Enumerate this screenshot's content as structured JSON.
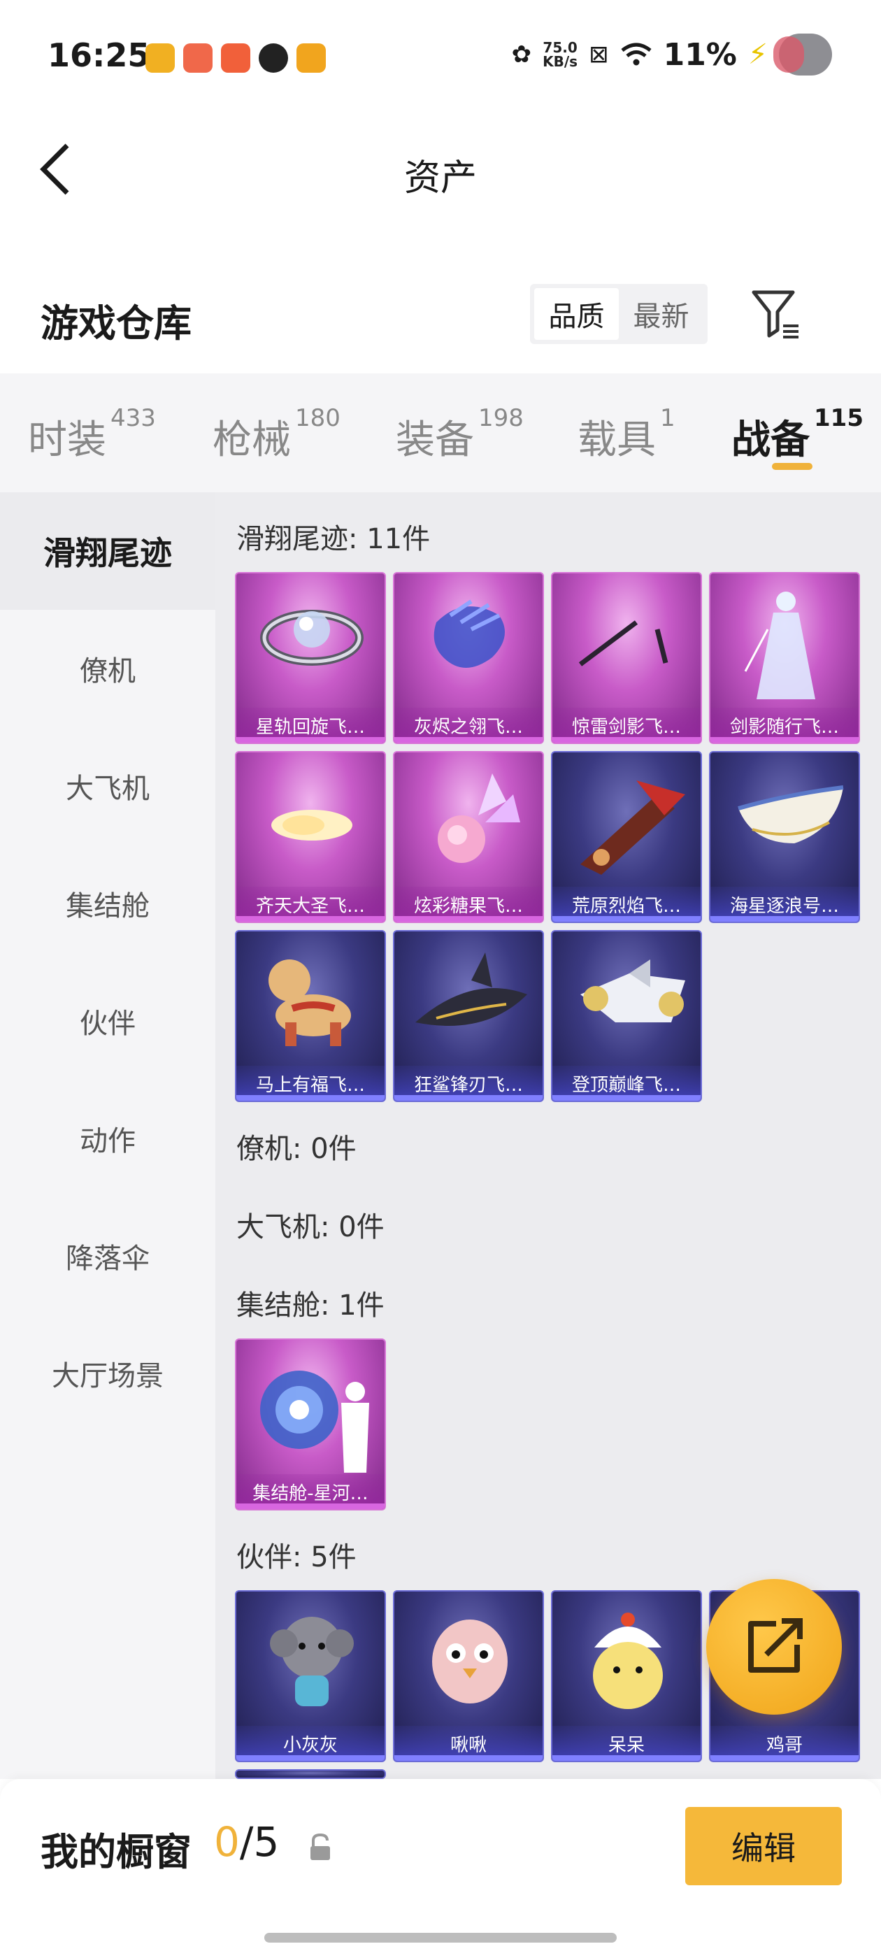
{
  "status_bar": {
    "time": "16:25",
    "net_speed": "75.0",
    "net_unit": "KB/s",
    "battery": "11%",
    "app_icon_colors": [
      "#f1b022",
      "#f0684a",
      "#f1603a",
      "#222222",
      "#f1a51e"
    ]
  },
  "header": {
    "title": "资产",
    "back_icon": "chevron-left-icon"
  },
  "warehouse": {
    "title": "游戏仓库",
    "sort_options": [
      "品质",
      "最新"
    ],
    "active_sort": "品质",
    "filter_icon": "filter-icon"
  },
  "tabs": [
    {
      "label": "时装",
      "count": "433"
    },
    {
      "label": "枪械",
      "count": "180"
    },
    {
      "label": "装备",
      "count": "198"
    },
    {
      "label": "载具",
      "count": "1"
    },
    {
      "label": "战备",
      "count": "115"
    }
  ],
  "active_tab": "战备",
  "sidebar": [
    "滑翔尾迹",
    "僚机",
    "大飞机",
    "集结舱",
    "伙伴",
    "动作",
    "降落伞",
    "大厅场景"
  ],
  "active_sidebar": "滑翔尾迹",
  "sections": {
    "glide_trail": {
      "title": "滑翔尾迹: 11件",
      "items": [
        {
          "label": "星轨回旋飞…",
          "rarity": "purple"
        },
        {
          "label": "灰烬之翎飞…",
          "rarity": "purple"
        },
        {
          "label": "惊雷剑影飞…",
          "rarity": "purple"
        },
        {
          "label": "剑影随行飞…",
          "rarity": "purple"
        },
        {
          "label": "齐天大圣飞…",
          "rarity": "purple"
        },
        {
          "label": "炫彩糖果飞…",
          "rarity": "purple"
        },
        {
          "label": "荒原烈焰飞…",
          "rarity": "blue"
        },
        {
          "label": "海星逐浪号…",
          "rarity": "blue"
        },
        {
          "label": "马上有福飞…",
          "rarity": "blue"
        },
        {
          "label": "狂鲨锋刃飞…",
          "rarity": "blue"
        },
        {
          "label": "登顶巅峰飞…",
          "rarity": "blue"
        }
      ]
    },
    "wingman": {
      "title": "僚机: 0件"
    },
    "big_plane": {
      "title": "大飞机: 0件"
    },
    "assembly_pod": {
      "title": "集结舱: 1件",
      "items": [
        {
          "label": "集结舱-星河…",
          "rarity": "purple"
        }
      ]
    },
    "partner": {
      "title": "伙伴: 5件",
      "items": [
        {
          "label": "小灰灰",
          "rarity": "blue"
        },
        {
          "label": "啾啾",
          "rarity": "blue"
        },
        {
          "label": "呆呆",
          "rarity": "blue"
        },
        {
          "label": "鸡哥",
          "rarity": "blue"
        }
      ]
    }
  },
  "fab": {
    "icon": "share-icon"
  },
  "showcase": {
    "title": "我的橱窗",
    "current": "0",
    "total": "/5",
    "lock_icon": "lock-icon",
    "edit_label": "编辑"
  }
}
